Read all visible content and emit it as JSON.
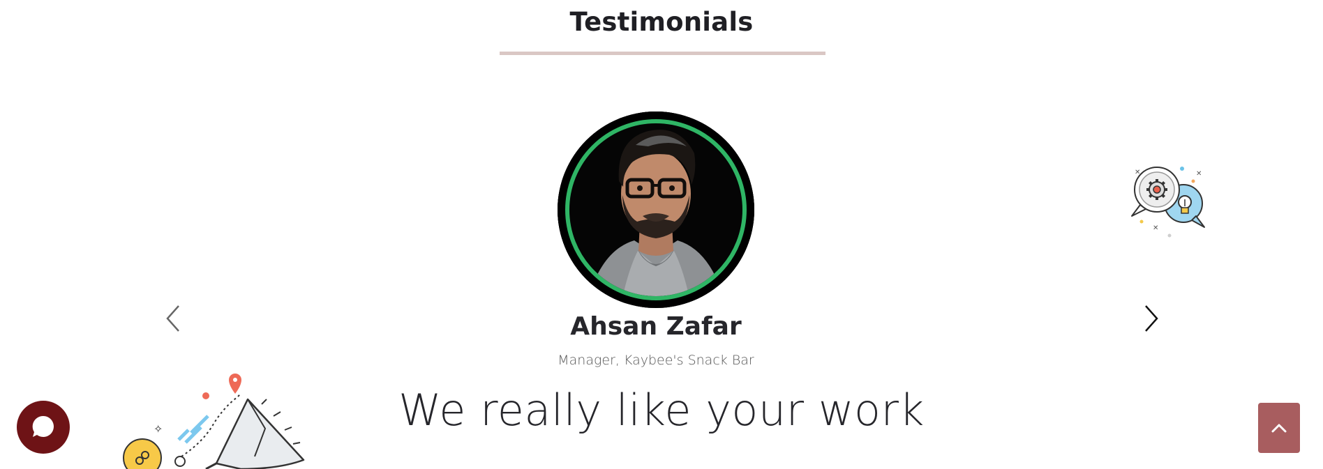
{
  "section": {
    "title": "Testimonials",
    "underline_color": "#dac7c4"
  },
  "testimonial": {
    "name": "Ahsan Zafar",
    "role": "Manager, Kaybee's Snack Bar",
    "quote": "We really like your work",
    "avatar_ring_color": "#2fb565"
  },
  "carousel": {
    "prev_icon": "chevron-left-icon",
    "next_icon": "chevron-right-icon"
  },
  "widgets": {
    "chat_icon": "chat-bubble-icon",
    "chat_color": "#6e1316",
    "back_to_top_icon": "chevron-up-icon",
    "back_to_top_color": "#a85d5f"
  },
  "decorations": {
    "top_right": "gear-lightbulb-chat-bubbles-icon",
    "bottom_left": "megaphone-marketing-icon"
  }
}
